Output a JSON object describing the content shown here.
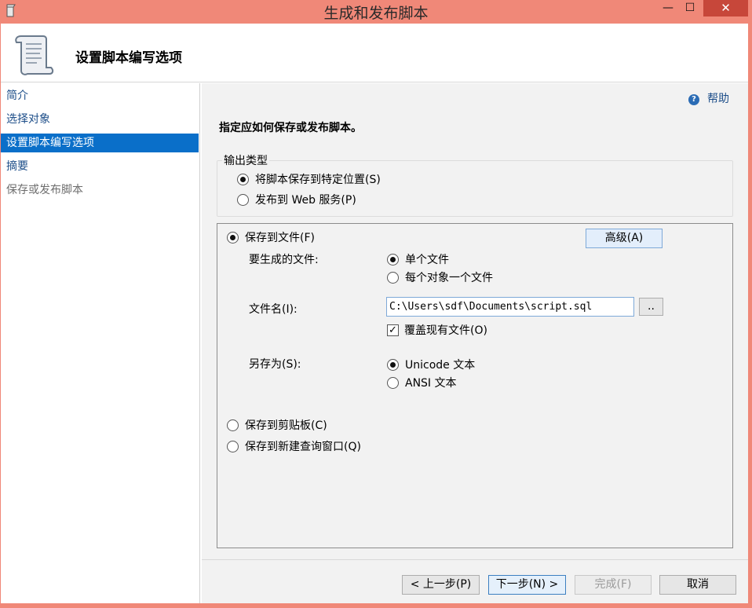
{
  "window": {
    "title": "生成和发布脚本",
    "minimize_glyph": "—",
    "maximize_glyph": "☐",
    "close_glyph": "✕"
  },
  "header": {
    "title": "设置脚本编写选项"
  },
  "sidebar": {
    "items": [
      {
        "label": "简介",
        "state": "normal"
      },
      {
        "label": "选择对象",
        "state": "normal"
      },
      {
        "label": "设置脚本编写选项",
        "state": "selected"
      },
      {
        "label": "摘要",
        "state": "normal"
      },
      {
        "label": "保存或发布脚本",
        "state": "disabled"
      }
    ]
  },
  "main": {
    "help_label": "帮助",
    "instruction": "指定应如何保存或发布脚本。",
    "output_type": {
      "legend": "输出类型",
      "options": [
        {
          "label": "将脚本保存到特定位置(S)",
          "selected": true
        },
        {
          "label": "发布到 Web 服务(P)",
          "selected": false
        }
      ]
    },
    "save_to_file": {
      "label": "保存到文件(F)",
      "selected": true,
      "advanced_button": "高级(A)",
      "files_label": "要生成的文件:",
      "files_options": [
        {
          "label": "单个文件",
          "selected": true
        },
        {
          "label": "每个对象一个文件",
          "selected": false
        }
      ],
      "filename_label": "文件名(I):",
      "filename_value": "C:\\Users\\sdf\\Documents\\script.sql",
      "browse_button": "..",
      "overwrite_label": "覆盖现有文件(O)",
      "overwrite_checked": true,
      "save_as_label": "另存为(S):",
      "save_as_options": [
        {
          "label": "Unicode 文本",
          "selected": true
        },
        {
          "label": "ANSI 文本",
          "selected": false
        }
      ]
    },
    "save_to_clipboard": {
      "label": "保存到剪贴板(C)",
      "selected": false
    },
    "save_to_query_window": {
      "label": "保存到新建查询窗口(Q)",
      "selected": false
    }
  },
  "footer": {
    "previous": "< 上一步(P)",
    "next": "下一步(N) >",
    "finish": "完成(F)",
    "cancel": "取消"
  },
  "colors": {
    "accent": "#0a6fc9",
    "titlebar": "#f08878",
    "close": "#c7473a"
  }
}
